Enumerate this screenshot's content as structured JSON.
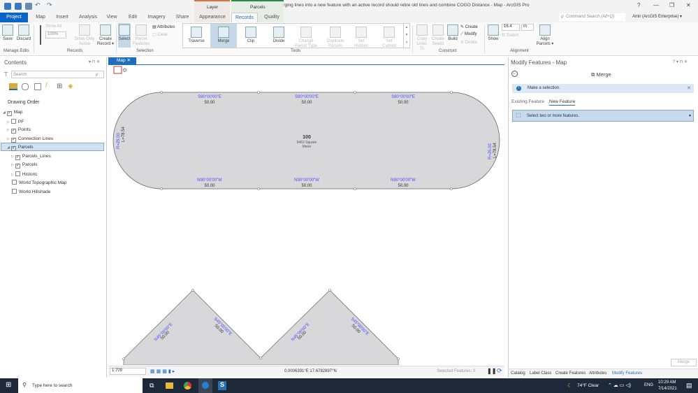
{
  "app": {
    "title": "2731 Merging lines into a new feature with an active record should retire old lines and combine COGO Distance - Map - ArcGIS Pro",
    "help": "?",
    "minimize": "—",
    "restore": "❐",
    "close": "✕"
  },
  "command_search": {
    "placeholder": "Command Search (Alt+Q)"
  },
  "user": {
    "name": "Amir (ArcGIS Enterprise) ▾"
  },
  "contextual": {
    "layer": "Layer",
    "parcels": "Parcels"
  },
  "tabs": [
    "Project",
    "Map",
    "Insert",
    "Analysis",
    "View",
    "Edit",
    "Imagery",
    "Share",
    "Appearance",
    "Records",
    "Quality"
  ],
  "ribbon": {
    "manage_edits": {
      "save": "Save",
      "discard": "Discard",
      "group": "Manage Edits"
    },
    "records": {
      "show_all": "Show All",
      "zoom": "100%",
      "show_only_active": "Show Only Active",
      "create_record": "Create Record ▾",
      "group": "Records"
    },
    "selection": {
      "select": "Select",
      "parcel_features": "Parcel Features",
      "attributes": "Attributes",
      "clear": "Clear",
      "group": "Selection"
    },
    "tools": {
      "traverse": "Traverse",
      "merge": "Merge",
      "clip": "Clip",
      "divide": "Divide",
      "change_parcel_type": "Change Parcel Type",
      "duplicate_parcels": "Duplicate Parcels",
      "set_historic": "Set Historic",
      "set_current": "Set Current",
      "group": "Tools"
    },
    "construct": {
      "copy_lines_to": "Copy Lines To",
      "create_seeds": "Create Seeds",
      "build": "Build",
      "create": "Create",
      "modify": "Modify",
      "delete": "Delete",
      "group": "Construct"
    },
    "alignment": {
      "show": "Show",
      "value": "16.4",
      "unit": "m",
      "switch": "Switch",
      "align_parcels": "Align Parcels ▾",
      "group": "Alignment"
    }
  },
  "contents": {
    "title": "Contents",
    "search_placeholder": "Search",
    "drawing_order": "Drawing Order",
    "layers": [
      {
        "label": "Map",
        "checked": true,
        "level": 0
      },
      {
        "label": "PF",
        "checked": false,
        "level": 1
      },
      {
        "label": "Points",
        "checked": true,
        "level": 1
      },
      {
        "label": "Connection Lines",
        "checked": true,
        "level": 1
      },
      {
        "label": "Parcels",
        "checked": true,
        "level": 1
      },
      {
        "label": "Parcels_Lines",
        "checked": true,
        "level": 2
      },
      {
        "label": "Parcels",
        "checked": true,
        "level": 2
      },
      {
        "label": "Historic",
        "checked": false,
        "level": 2
      },
      {
        "label": "World Topographic Map",
        "checked": false,
        "level": 1
      },
      {
        "label": "World Hillshade",
        "checked": false,
        "level": 1
      }
    ]
  },
  "map": {
    "tab": "Map",
    "parcel": {
      "name": "100",
      "area": "9463 Square",
      "unit": "Meter"
    },
    "top_bearing": "S90°00'00\"E",
    "bottom_bearing": "N90°00'00\"W",
    "distance": "50.00",
    "radius": "R=25.00",
    "arc_length": "L=78.54",
    "ne_bearing": "N45°00'00\"E",
    "se_bearing": "S45°00'00\"E"
  },
  "statusbar": {
    "scale": "1:709",
    "coords": "0.0006391°E 17.6782897°N",
    "selected": "Selected Features: 0"
  },
  "modify": {
    "title": "Modify Features - Map",
    "tool": "Merge",
    "message": "Make a selection.",
    "tab_existing": "Existing Feature",
    "tab_new": "New Feature",
    "select_prompt": "Select two or more features.",
    "merge_button": "Merge",
    "bottom_tabs": [
      "Catalog",
      "Label Class",
      "Create Features",
      "Attributes",
      "Modify Features"
    ]
  },
  "taskbar": {
    "search": "Type here to search",
    "weather": "74°F  Clear",
    "lang": "ENG",
    "time": "10:29 AM",
    "date": "7/14/2021"
  }
}
